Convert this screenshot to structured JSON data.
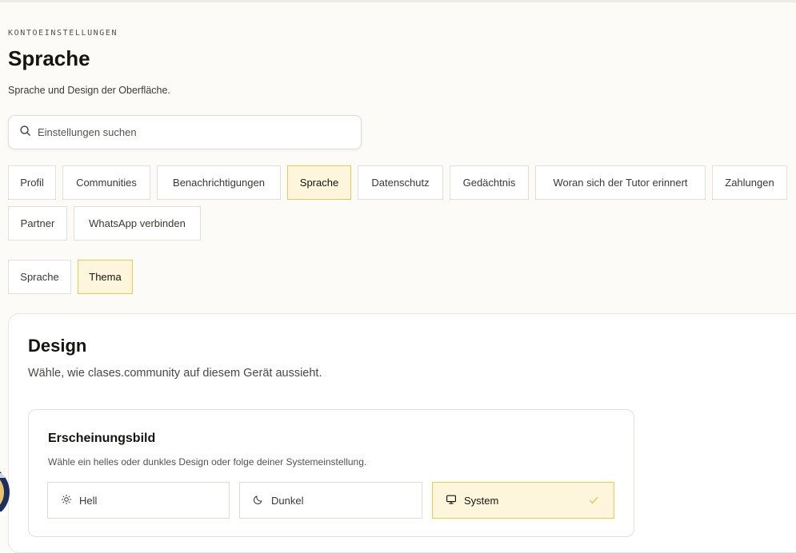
{
  "header": {
    "eyebrow": "KONTOEINSTELLUNGEN",
    "title": "Sprache",
    "subtitle": "Sprache und Design der Oberfläche."
  },
  "search": {
    "placeholder": "Einstellungen suchen"
  },
  "main_tabs": [
    {
      "label": "Profil",
      "active": false
    },
    {
      "label": "Communities",
      "active": false
    },
    {
      "label": "Benachrichtigungen",
      "active": false
    },
    {
      "label": "Sprache",
      "active": true
    },
    {
      "label": "Datenschutz",
      "active": false
    },
    {
      "label": "Gedächtnis",
      "active": false
    },
    {
      "label": "Woran sich der Tutor erinnert",
      "active": false
    },
    {
      "label": "Zahlungen",
      "active": false
    },
    {
      "label": "Partner",
      "active": false
    },
    {
      "label": "WhatsApp verbinden",
      "active": false
    }
  ],
  "sub_tabs": [
    {
      "label": "Sprache",
      "active": false
    },
    {
      "label": "Thema",
      "active": true
    }
  ],
  "design": {
    "title": "Design",
    "description": "Wähle, wie clases.community auf diesem Gerät aussieht."
  },
  "appearance": {
    "title": "Erscheinungsbild",
    "description": "Wähle ein helles oder dunkles Design oder folge deiner Systemeinstellung.",
    "options": [
      {
        "label": "Hell",
        "icon": "sun-icon",
        "selected": false
      },
      {
        "label": "Dunkel",
        "icon": "moon-icon",
        "selected": false
      },
      {
        "label": "System",
        "icon": "monitor-icon",
        "selected": true
      }
    ]
  },
  "colors": {
    "accent": "#f0cb48",
    "accent_bg": "#fdf6dc",
    "page_bg": "#fcfbf8"
  }
}
